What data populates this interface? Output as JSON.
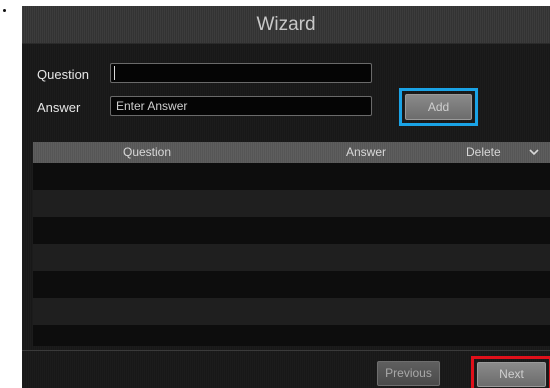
{
  "dialog": {
    "title": "Wizard"
  },
  "form": {
    "question_label": "Question",
    "question_value": "",
    "answer_label": "Answer",
    "answer_placeholder": "Enter Answer",
    "add_label": "Add"
  },
  "table": {
    "columns": [
      "Question",
      "Answer",
      "Delete"
    ],
    "rows": []
  },
  "footer": {
    "previous_label": "Previous",
    "next_label": "Next"
  },
  "colors": {
    "add_highlight": "#1aa3e6",
    "next_highlight": "#e0101a"
  }
}
